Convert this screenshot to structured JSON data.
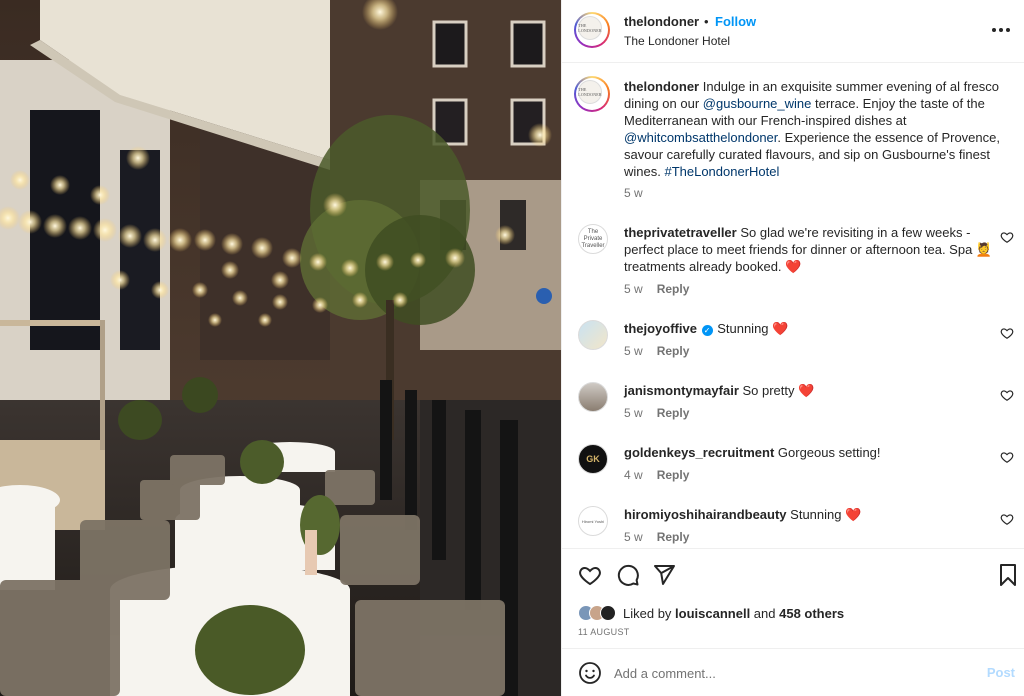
{
  "header": {
    "username": "thelondoner",
    "dot": "•",
    "follow_label": "Follow",
    "location": "The Londoner Hotel",
    "avatar_text": "THE LONDONER"
  },
  "caption": {
    "username": "thelondoner",
    "text_1": " Indulge in an exquisite summer evening of al fresco dining on our ",
    "mention_1": "@gusbourne_wine",
    "text_2": " terrace. Enjoy the taste of the Mediterranean with our French-inspired dishes at ",
    "mention_2": "@whitcombsatthelondoner",
    "text_3": ". Experience the essence of Provence, savour carefully curated flavours, and sip on Gusbourne's finest wines. ",
    "hashtag": "#TheLondonerHotel",
    "time": "5 w"
  },
  "comments": [
    {
      "username": "theprivatetraveller",
      "text": " So glad we're revisiting in a few weeks - perfect place to meet friends for dinner or afternoon tea. Spa 💆 treatments already booked. ",
      "heart": "❤️",
      "time": "5 w",
      "reply": "Reply",
      "avatar_text": "The Private Traveller"
    },
    {
      "username": "thejoyoffive",
      "verified": "✓",
      "text": " Stunning ",
      "heart": "❤️",
      "time": "5 w",
      "reply": "Reply"
    },
    {
      "username": "janismontymayfair",
      "text": " So pretty ",
      "heart": "❤️",
      "time": "5 w",
      "reply": "Reply"
    },
    {
      "username": "goldenkeys_recruitment",
      "text": " Gorgeous setting!",
      "heart": "",
      "time": "4 w",
      "reply": "Reply",
      "avatar_text": "GK"
    },
    {
      "username": "hiromiyoshihairandbeauty",
      "text": " Stunning ",
      "heart": "❤️",
      "time": "5 w",
      "reply": "Reply",
      "avatar_text": "Hiromi Yoshi"
    }
  ],
  "actions": {
    "liked_by_prefix": "Liked by ",
    "liked_by_user": "louiscannell",
    "liked_by_and": " and ",
    "likes_count": "458 others",
    "date": "11 AUGUST"
  },
  "add_comment": {
    "placeholder": "Add a comment...",
    "post_label": "Post"
  },
  "colors": {
    "link": "#00376b",
    "follow": "#0095f6",
    "heart": "#ed4956",
    "post_disabled": "#b3dbff"
  }
}
